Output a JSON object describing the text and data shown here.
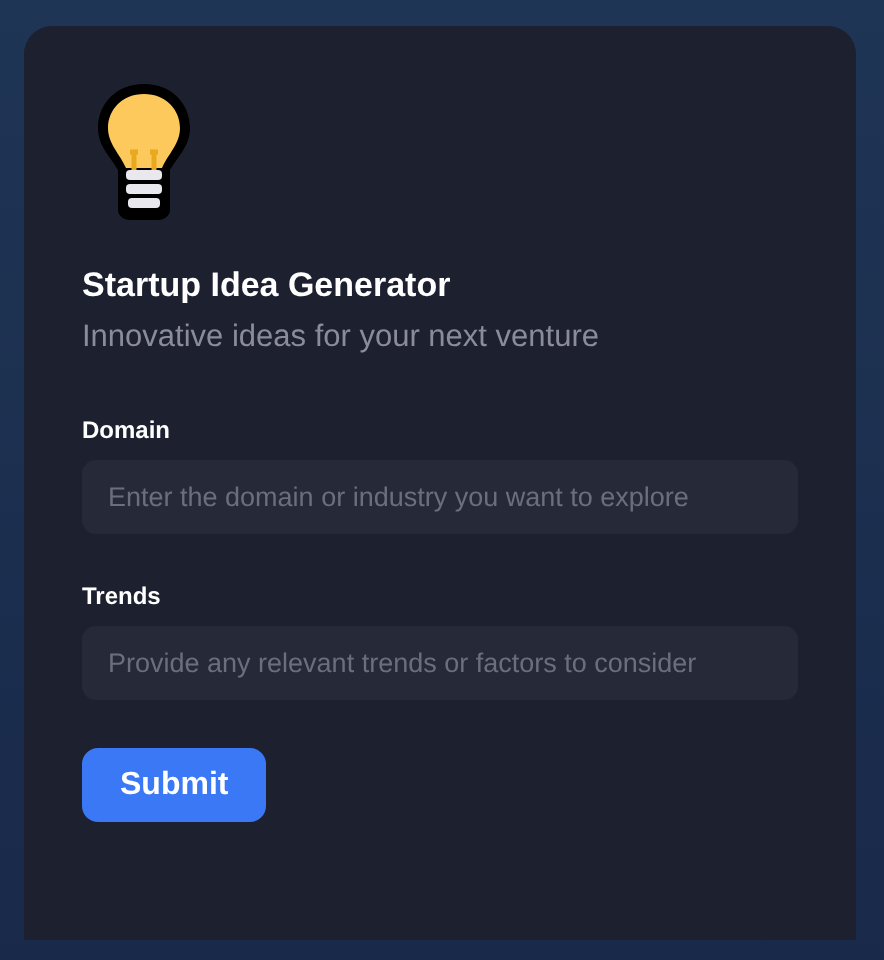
{
  "header": {
    "title": "Startup Idea Generator",
    "subtitle": "Innovative ideas for your next venture"
  },
  "fields": [
    {
      "label": "Domain",
      "placeholder": "Enter the domain or industry you want to explore"
    },
    {
      "label": "Trends",
      "placeholder": "Provide any relevant trends or factors to consider"
    }
  ],
  "button": "Submit"
}
